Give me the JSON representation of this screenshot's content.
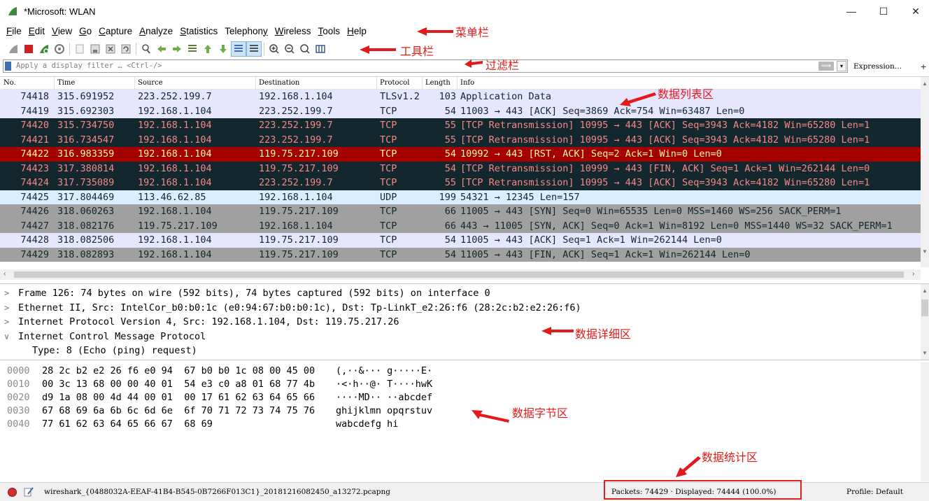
{
  "window": {
    "title": "*Microsoft: WLAN",
    "minimize": "—",
    "maximize": "☐",
    "close": "✕"
  },
  "menu": [
    "File",
    "Edit",
    "View",
    "Go",
    "Capture",
    "Analyze",
    "Statistics",
    "Telephony",
    "Wireless",
    "Tools",
    "Help"
  ],
  "filter": {
    "placeholder": "Apply a display filter … <Ctrl-/>",
    "apply_arrow": "⟹",
    "expression": "Expression…",
    "plus": "+"
  },
  "packet_list": {
    "columns": [
      "No.",
      "Time",
      "Source",
      "Destination",
      "Protocol",
      "Length",
      "Info"
    ],
    "rows": [
      {
        "no": "74418",
        "time": "315.691952",
        "src": "223.252.199.7",
        "dst": "192.168.1.104",
        "proto": "TLSv1.2",
        "len": "103",
        "info": "Application Data",
        "bg": "#e7e6ff",
        "fg": "#12272e"
      },
      {
        "no": "74419",
        "time": "315.692303",
        "src": "192.168.1.104",
        "dst": "223.252.199.7",
        "proto": "TCP",
        "len": "54",
        "info": "11003 → 443 [ACK] Seq=3869 Ack=754 Win=63487 Len=0",
        "bg": "#e7e6ff",
        "fg": "#12272e"
      },
      {
        "no": "74420",
        "time": "315.734750",
        "src": "192.168.1.104",
        "dst": "223.252.199.7",
        "proto": "TCP",
        "len": "55",
        "info": "[TCP Retransmission] 10995 → 443 [ACK] Seq=3943 Ack=4182 Win=65280 Len=1",
        "bg": "#12272e",
        "fg": "#f78787"
      },
      {
        "no": "74421",
        "time": "316.734547",
        "src": "192.168.1.104",
        "dst": "223.252.199.7",
        "proto": "TCP",
        "len": "55",
        "info": "[TCP Retransmission] 10995 → 443 [ACK] Seq=3943 Ack=4182 Win=65280 Len=1",
        "bg": "#12272e",
        "fg": "#f78787"
      },
      {
        "no": "74422",
        "time": "316.983359",
        "src": "192.168.1.104",
        "dst": "119.75.217.109",
        "proto": "TCP",
        "len": "54",
        "info": "10992 → 443 [RST, ACK] Seq=2 Ack=1 Win=0 Len=0",
        "bg": "#a40000",
        "fg": "#fffc9c"
      },
      {
        "no": "74423",
        "time": "317.380814",
        "src": "192.168.1.104",
        "dst": "119.75.217.109",
        "proto": "TCP",
        "len": "54",
        "info": "[TCP Retransmission] 10999 → 443 [FIN, ACK] Seq=1 Ack=1 Win=262144 Len=0",
        "bg": "#12272e",
        "fg": "#f78787"
      },
      {
        "no": "74424",
        "time": "317.735089",
        "src": "192.168.1.104",
        "dst": "223.252.199.7",
        "proto": "TCP",
        "len": "55",
        "info": "[TCP Retransmission] 10995 → 443 [ACK] Seq=3943 Ack=4182 Win=65280 Len=1",
        "bg": "#12272e",
        "fg": "#f78787"
      },
      {
        "no": "74425",
        "time": "317.804469",
        "src": "113.46.62.85",
        "dst": "192.168.1.104",
        "proto": "UDP",
        "len": "199",
        "info": "54321 → 12345 Len=157",
        "bg": "#daeeff",
        "fg": "#12272e"
      },
      {
        "no": "74426",
        "time": "318.060263",
        "src": "192.168.1.104",
        "dst": "119.75.217.109",
        "proto": "TCP",
        "len": "66",
        "info": "11005 → 443 [SYN] Seq=0 Win=65535 Len=0 MSS=1460 WS=256 SACK_PERM=1",
        "bg": "#a0a0a0",
        "fg": "#12272e"
      },
      {
        "no": "74427",
        "time": "318.082176",
        "src": "119.75.217.109",
        "dst": "192.168.1.104",
        "proto": "TCP",
        "len": "66",
        "info": "443 → 11005 [SYN, ACK] Seq=0 Ack=1 Win=8192 Len=0 MSS=1440 WS=32 SACK_PERM=1",
        "bg": "#a0a0a0",
        "fg": "#12272e"
      },
      {
        "no": "74428",
        "time": "318.082506",
        "src": "192.168.1.104",
        "dst": "119.75.217.109",
        "proto": "TCP",
        "len": "54",
        "info": "11005 → 443 [ACK] Seq=1 Ack=1 Win=262144 Len=0",
        "bg": "#e7e6ff",
        "fg": "#12272e"
      },
      {
        "no": "74429",
        "time": "318.082893",
        "src": "192.168.1.104",
        "dst": "119.75.217.109",
        "proto": "TCP",
        "len": "54",
        "info": "11005 → 443 [FIN, ACK] Seq=1 Ack=1 Win=262144 Len=0",
        "bg": "#a0a0a0",
        "fg": "#12272e"
      }
    ]
  },
  "details": [
    {
      "arrow": ">",
      "text": "Frame 126: 74 bytes on wire (592 bits), 74 bytes captured (592 bits) on interface 0",
      "child": false
    },
    {
      "arrow": ">",
      "text": "Ethernet II, Src: IntelCor_b0:b0:1c (e0:94:67:b0:b0:1c), Dst: Tp-LinkT_e2:26:f6 (28:2c:b2:e2:26:f6)",
      "child": false
    },
    {
      "arrow": ">",
      "text": "Internet Protocol Version 4, Src: 192.168.1.104, Dst: 119.75.217.26",
      "child": false
    },
    {
      "arrow": "∨",
      "text": "Internet Control Message Protocol",
      "child": false
    },
    {
      "arrow": "",
      "text": "Type: 8 (Echo (ping) request)",
      "child": true
    }
  ],
  "bytes": [
    {
      "offset": "0000",
      "hex": "28 2c b2 e2 26 f6 e0 94  67 b0 b0 1c 08 00 45 00",
      "ascii": "(,··&··· g·····E·"
    },
    {
      "offset": "0010",
      "hex": "00 3c 13 68 00 00 40 01  54 e3 c0 a8 01 68 77 4b",
      "ascii": "·<·h··@· T····hwK"
    },
    {
      "offset": "0020",
      "hex": "d9 1a 08 00 4d 44 00 01  00 17 61 62 63 64 65 66",
      "ascii": "····MD·· ··abcdef"
    },
    {
      "offset": "0030",
      "hex": "67 68 69 6a 6b 6c 6d 6e  6f 70 71 72 73 74 75 76",
      "ascii": "ghijklmn opqrstuv"
    },
    {
      "offset": "0040",
      "hex": "77 61 62 63 64 65 66 67  68 69",
      "ascii": "wabcdefg hi"
    }
  ],
  "status": {
    "file": "wireshark_{0488032A-EEAF-41B4-B545-0B7266F013C1}_20181216082450_a13272.pcapng",
    "packets": "Packets: 74429 · Displayed: 74444 (100.0%)",
    "profile": "Profile: Default"
  },
  "annotations": {
    "menubar": "菜单栏",
    "toolbar": "工具栏",
    "filterbar": "过滤栏",
    "packet_list": "数据列表区",
    "details": "数据详细区",
    "bytes": "数据字节区",
    "stats": "数据统计区"
  },
  "colors": {
    "annotation_red": "#e31a1a",
    "wireshark_fin": "#3b8a3f"
  }
}
